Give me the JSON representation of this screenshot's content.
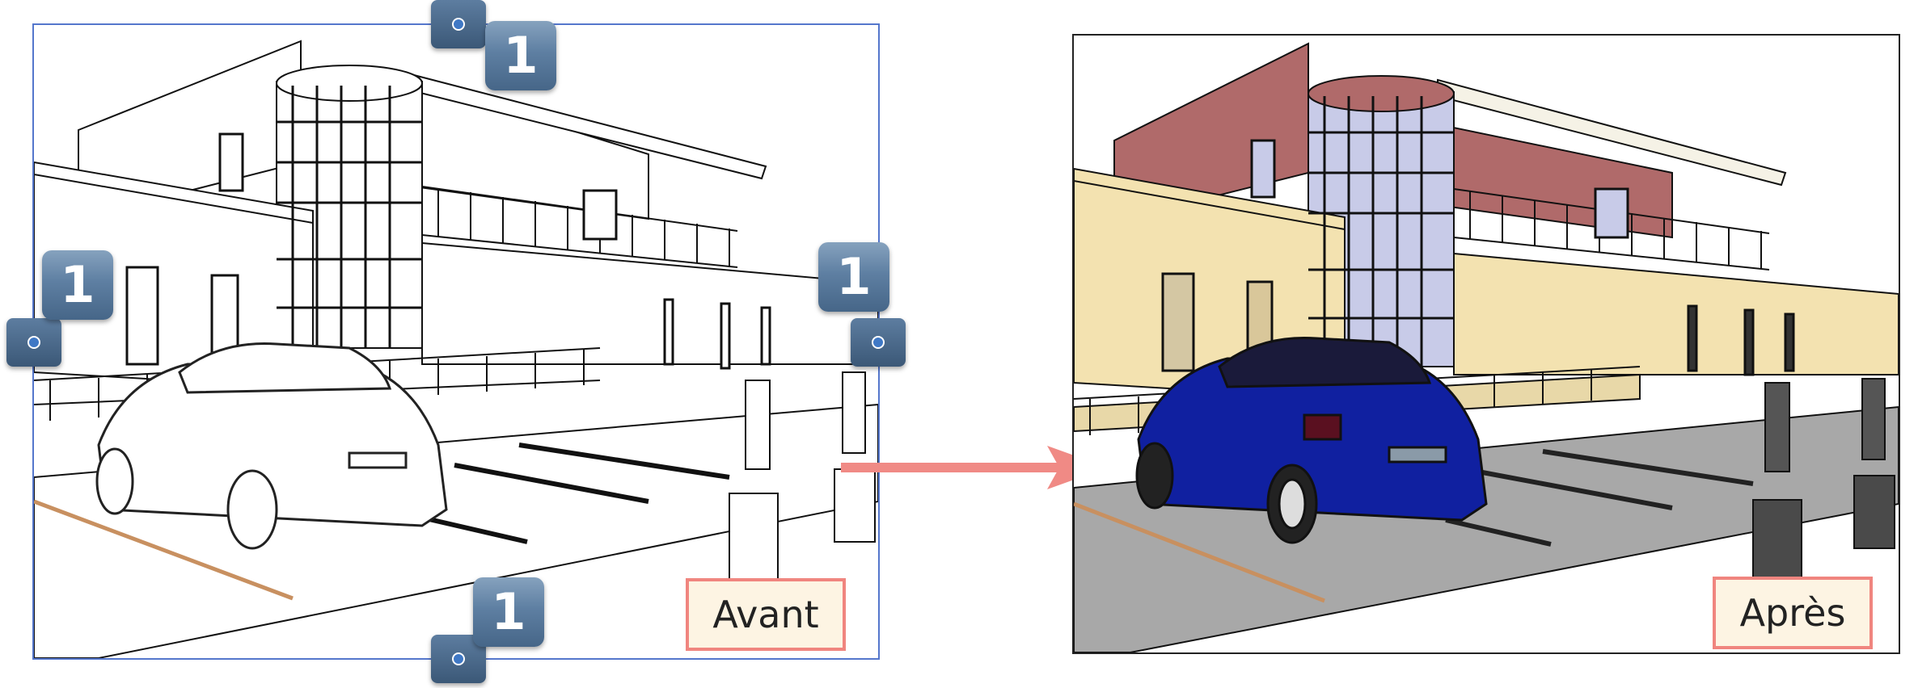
{
  "before": {
    "label": "Avant"
  },
  "after": {
    "label": "Après"
  },
  "controls": {
    "badge_value": "1"
  },
  "colors": {
    "accent_frame": "#5577cc",
    "label_border": "#f0857f",
    "label_fill": "#fdf4e3",
    "arrow": "#f08a85",
    "badge": "#5e7fa2",
    "car_after": "#1020a0",
    "wall_red": "#b06a6a",
    "wall_beige": "#f3e2b0",
    "pavement": "#a8a8a8"
  },
  "icons": {
    "badge": "number-badge",
    "handle": "resize-handle-icon",
    "arrow": "right-arrow-icon"
  }
}
